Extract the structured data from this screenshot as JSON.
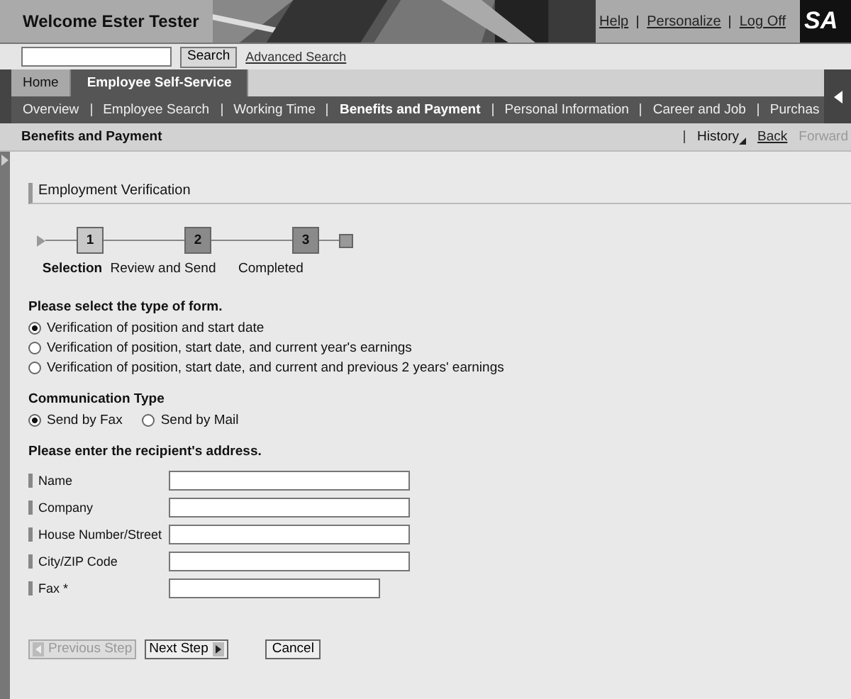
{
  "header": {
    "welcome": "Welcome Ester Tester",
    "links": [
      "Help",
      "Personalize",
      "Log Off"
    ],
    "logo": "SA"
  },
  "search": {
    "button": "Search",
    "link": "Advanced Search"
  },
  "tabs": [
    {
      "label": "Home",
      "selected": false
    },
    {
      "label": "Employee Self-Service",
      "selected": true
    }
  ],
  "subnav": [
    {
      "label": "Overview",
      "selected": false
    },
    {
      "label": "Employee Search",
      "selected": false
    },
    {
      "label": "Working Time",
      "selected": false
    },
    {
      "label": "Benefits and Payment",
      "selected": true
    },
    {
      "label": "Personal Information",
      "selected": false
    },
    {
      "label": "Career and Job",
      "selected": false
    },
    {
      "label": "Purchas",
      "selected": false
    }
  ],
  "page_title": "Benefits and Payment",
  "history": {
    "label": "History",
    "back": "Back",
    "forward": "Forward",
    "forward_disabled": true
  },
  "section_title": "Employment Verification",
  "steps": [
    {
      "number": "1",
      "label": "Selection",
      "selected": true
    },
    {
      "number": "2",
      "label": "Review and Send",
      "selected": false
    },
    {
      "number": "3",
      "label": "Completed",
      "selected": false
    }
  ],
  "form_type": {
    "label": "Please select the type of form.",
    "options": [
      {
        "label": "Verification of position and start date",
        "selected": true
      },
      {
        "label": "Verification of position, start date, and current year's earnings",
        "selected": false
      },
      {
        "label": "Verification of position, start date, and current and previous 2 years' earnings",
        "selected": false
      }
    ]
  },
  "communication": {
    "label": "Communication Type",
    "options": [
      {
        "label": "Send by Fax",
        "selected": true
      },
      {
        "label": "Send by Mail",
        "selected": false
      }
    ]
  },
  "address": {
    "label": "Please enter the recipient's address.",
    "fields": [
      {
        "label": "Name",
        "short": false
      },
      {
        "label": "Company",
        "short": false
      },
      {
        "label": "House Number/Street",
        "short": false
      },
      {
        "label": "City/ZIP Code",
        "short": false
      },
      {
        "label": "Fax *",
        "short": true
      }
    ]
  },
  "buttons": [
    {
      "label": "Previous Step",
      "kind": "prev",
      "disabled": true
    },
    {
      "label": "Next Step",
      "kind": "next",
      "disabled": false
    },
    {
      "label": "Cancel",
      "kind": "plain",
      "disabled": false
    }
  ]
}
